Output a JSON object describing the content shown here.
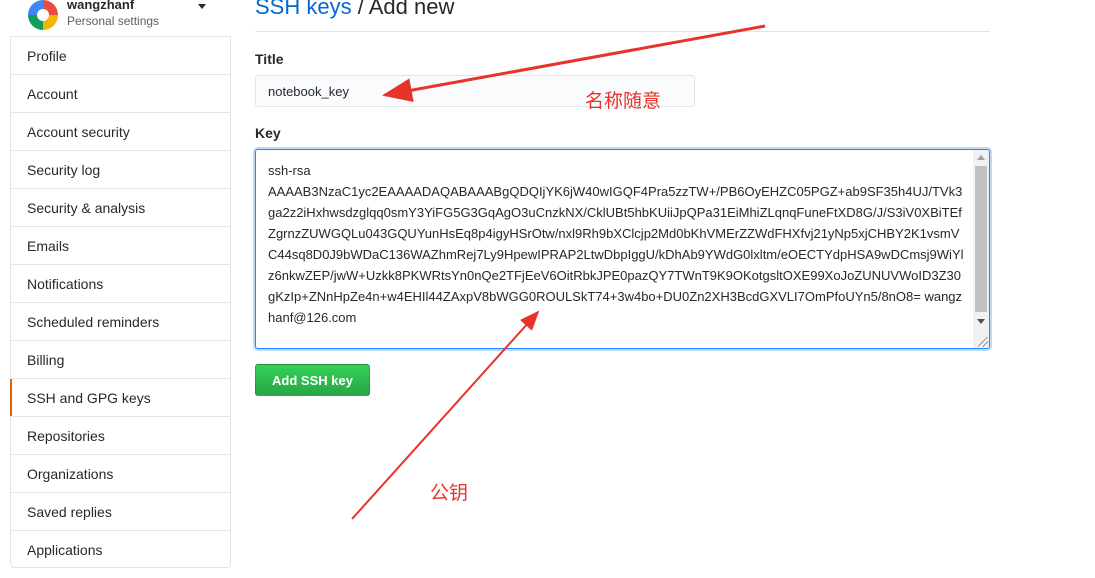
{
  "user": {
    "name": "wangzhanf",
    "subtitle": "Personal settings"
  },
  "sidebar": {
    "items": [
      {
        "label": "Profile"
      },
      {
        "label": "Account"
      },
      {
        "label": "Account security"
      },
      {
        "label": "Security log"
      },
      {
        "label": "Security & analysis"
      },
      {
        "label": "Emails"
      },
      {
        "label": "Notifications"
      },
      {
        "label": "Scheduled reminders"
      },
      {
        "label": "Billing"
      },
      {
        "label": "SSH and GPG keys",
        "selected": true
      },
      {
        "label": "Repositories"
      },
      {
        "label": "Organizations"
      },
      {
        "label": "Saved replies"
      },
      {
        "label": "Applications"
      }
    ]
  },
  "page": {
    "breadcrumb": "SSH keys",
    "separator": " / ",
    "title": "Add new"
  },
  "form": {
    "title_label": "Title",
    "title_value": "notebook_key",
    "key_label": "Key",
    "key_value": "ssh-rsa\nAAAAB3NzaC1yc2EAAAADAQABAAABgQDQIjYK6jW40wIGQF4Pra5zzTW+/PB6OyEHZC05PGZ+ab9SF35h4UJ/TVk3ga2z2iHxhwsdzglqq0smY3YiFG5G3GqAgO3uCnzkNX/CklUBt5hbKUiiJpQPa31EiMhiZLqnqFuneFtXD8G/J/S3iV0XBiTEfZgrnzZUWGQLu043GQUYunHsEq8p4igyHSrOtw/nxl9Rh9bXClcjp2Md0bKhVMErZZWdFHXfvj21yNp5xjCHBY2K1vsmVC44sq8D0J9bWDaC136WAZhmRej7Ly9HpewIPRAP2LtwDbpIggU/kDhAb9YWdG0lxltm/eOECTYdpHSA9wDCmsj9WiYlz6nkwZEP/jwW+Uzkk8PKWRtsYn0nQe2TFjEeV6OitRbkJPE0pazQY7TWnT9K9OKotgsltOXE99XoJoZUNUVWoID3Z30gKzIp+ZNnHpZe4n+w4EHIl44ZAxpV8bWGG0ROULSkT74+3w4bo+DU0Zn2XH3BcdGXVLI7OmPfoUYn5/8nO8= wangzhanf@126.com",
    "submit_label": "Add SSH key"
  },
  "annotations": {
    "title_note": "名称随意",
    "key_note": "公钥",
    "color": "#e8332a"
  },
  "colors": {
    "link": "#0366d6",
    "button_green": "#28a745",
    "selected_marker": "#e36209",
    "focus_border": "#2188ff"
  },
  "icons": {
    "user_menu_caret": "caret-down-icon",
    "avatar": "avatar-image"
  }
}
